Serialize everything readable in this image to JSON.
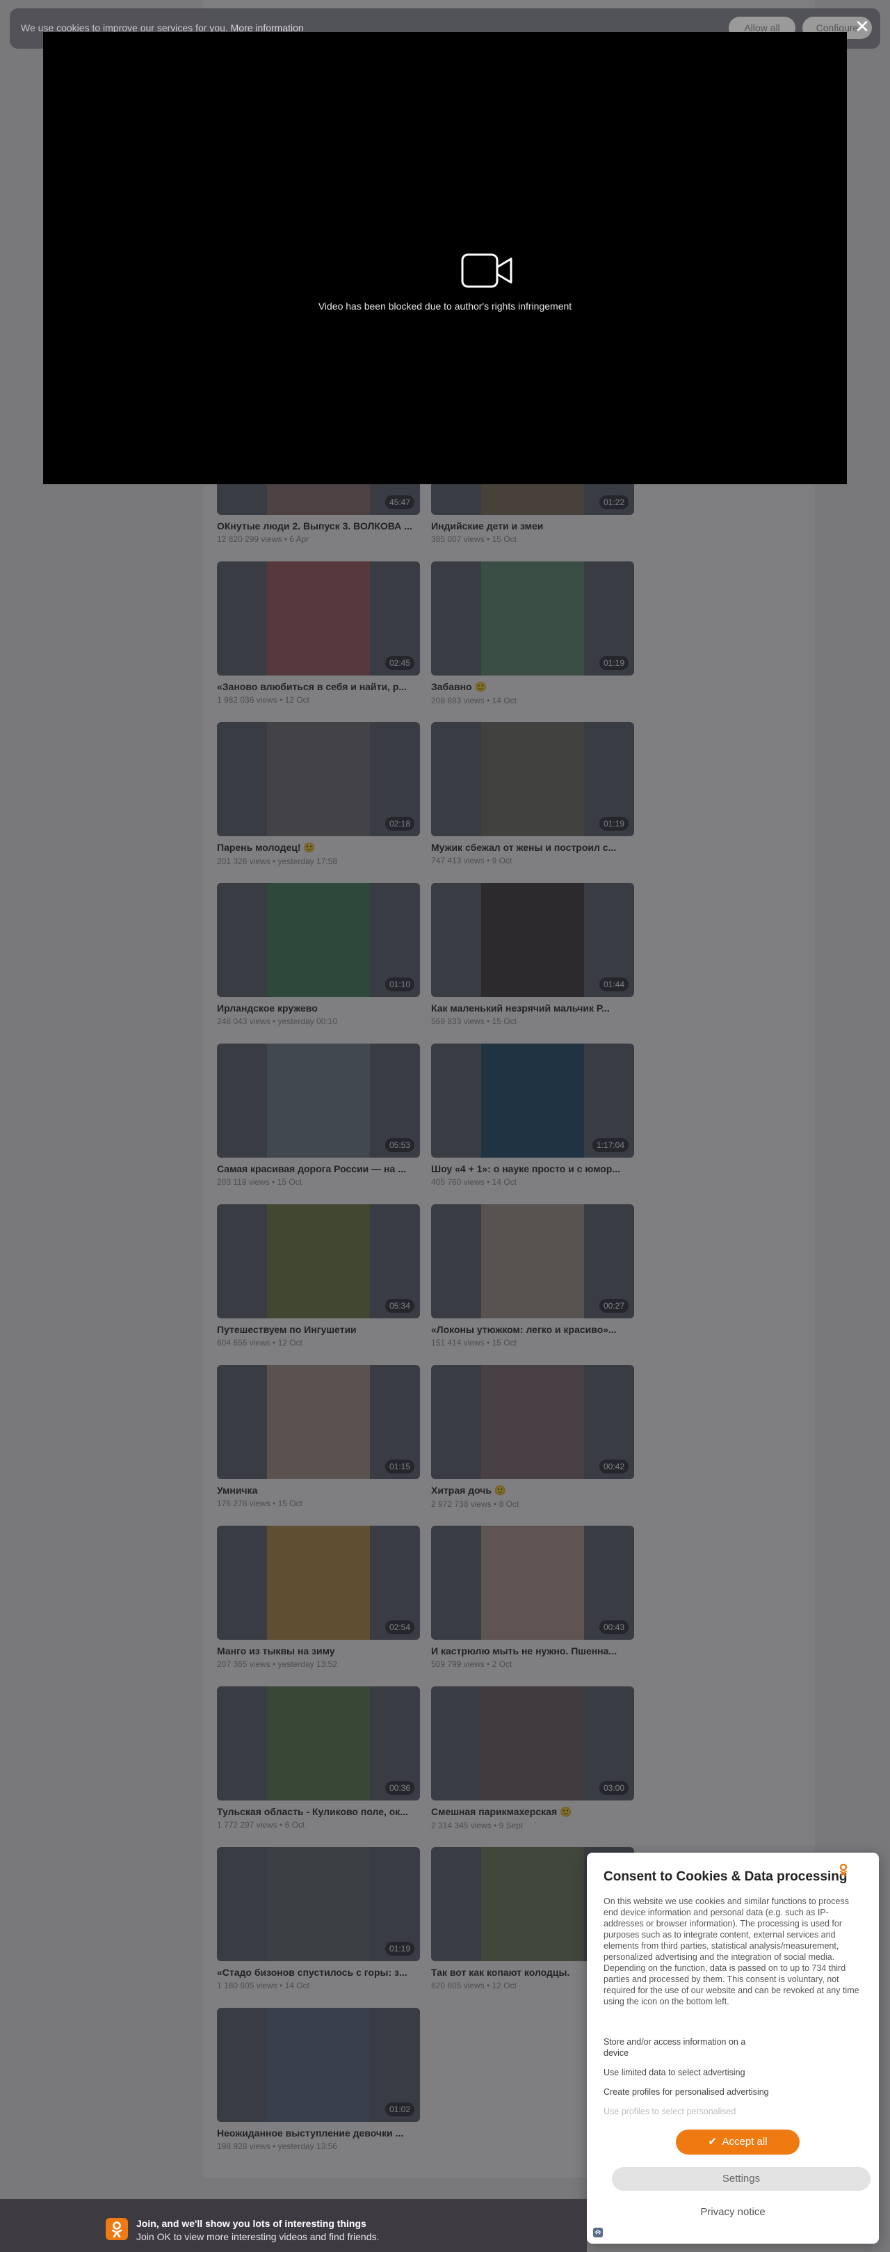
{
  "cookie_bar": {
    "text": "We use cookies to improve our services for you.",
    "link": "More information",
    "allow_all": "Allow all",
    "configure": "Configure"
  },
  "player": {
    "blocked_message": "Video has been blocked due to author's rights infringement",
    "icon": "video-camera-icon"
  },
  "videos": [
    {
      "title": "ОКнутые люди 2. Выпуск 3. ВОЛКОВА ...",
      "meta": "12 820 299 views • 6 Apr",
      "duration": "45:47",
      "color": "#8a6d6a"
    },
    {
      "title": "Индийские дети и змеи",
      "meta": "385 007 views • 15 Oct",
      "duration": "01:22",
      "color": "#7d6c54"
    },
    {
      "title": "«Заново влюбиться в себя и найти, р...",
      "meta": "1 982 036 views • 12 Oct",
      "duration": "02:45",
      "color": "#a0565a"
    },
    {
      "title": "Забавно 🙂",
      "meta": "208 883 views • 14 Oct",
      "duration": "01:19",
      "color": "#5d8a70"
    },
    {
      "title": "Парень молодец! 🙂",
      "meta": "201 326 views • yesterday 17:58",
      "duration": "02:18",
      "color": "#6e6e72"
    },
    {
      "title": "Мужик сбежал от жены и построил с...",
      "meta": "747 413 views • 9 Oct",
      "duration": "01:19",
      "color": "#6b6e60"
    },
    {
      "title": "Ирландское кружево",
      "meta": "248 043 views • yesterday 00:10",
      "duration": "01:10",
      "color": "#3f7d5a"
    },
    {
      "title": "Как маленький незрячий мальчик Р...",
      "meta": "569 833 views • 15 Oct",
      "duration": "01:44",
      "color": "#3a3634"
    },
    {
      "title": "Самая красивая дорога России — на ...",
      "meta": "203 119 views • 15 Oct",
      "duration": "05:53",
      "color": "#6f7d88"
    },
    {
      "title": "Шоу «4 + 1»: о науке просто и с юмор...",
      "meta": "405 760 views • 14 Oct",
      "duration": "1:17:04",
      "color": "#1c4a6a"
    },
    {
      "title": "Путешествуем по Ингушетии",
      "meta": "604 656 views • 12 Oct",
      "duration": "05:34",
      "color": "#6e7a3e"
    },
    {
      "title": "«Локоны утюжком: легко и красиво»...",
      "meta": "151 414 views • 15 Oct",
      "duration": "00:27",
      "color": "#a3958a"
    },
    {
      "title": "Умничка",
      "meta": "176 278 views • 15 Oct",
      "duration": "01:15",
      "color": "#a49484"
    },
    {
      "title": "Хитрая дочь 🙂",
      "meta": "2 972 738 views • 8 Oct",
      "duration": "00:42",
      "color": "#7c6a6e"
    },
    {
      "title": "Манго из тыквы на зиму",
      "meta": "207 365 views • yesterday 13:52",
      "duration": "02:54",
      "color": "#b48a3a"
    },
    {
      "title": "И кастрюлю мыть не нужно. Пшенна...",
      "meta": "509 799 views • 2 Oct",
      "duration": "00:43",
      "color": "#b29a8a"
    },
    {
      "title": "Тульская область - Куликово поле, ок...",
      "meta": "1 772 297 views • 6 Oct",
      "duration": "00:36",
      "color": "#5a7a4a"
    },
    {
      "title": "Смешная парикмахерская 🙂",
      "meta": "2 314 345 views • 9 Sept",
      "duration": "03:00",
      "color": "#6a5a5e"
    },
    {
      "title": "«Стадо бизонов спустилось с горы: з...",
      "meta": "1 180 605 views • 14 Oct",
      "duration": "01:19",
      "color": "#5e6a6e"
    },
    {
      "title": "Так вот как копают колодцы.",
      "meta": "620 605 views • 12 Oct",
      "duration": "",
      "color": "#6e7a5a"
    },
    {
      "title": "Неожиданное выступление девочки ...",
      "meta": "198 928 views • yesterday 13:56",
      "duration": "01:02",
      "color": "#5a6a7e"
    }
  ],
  "consent": {
    "title": "Consent to Cookies & Data processing",
    "description": "On this website we use cookies and similar functions to process end device information and personal data (e.g. such as IP-addresses or browser information). The processing is used for purposes such as to integrate content, external services and elements from third parties, statistical analysis/measurement, personalized advertising and the integration of social media. Depending on the function, data is passed on to up to 734 third parties and processed by them. This consent is voluntary, not required for the use of our website and can be revoked at any time using the icon on the bottom left.",
    "purposes": [
      "Store and/or access information on a device",
      "Use limited data to select advertising",
      "Create profiles for personalised advertising",
      "Use profiles to select personalised"
    ],
    "accept_label": "Accept all",
    "settings_label": "Settings",
    "privacy_label": "Privacy notice",
    "accent": "#f07a12"
  },
  "join_bar": {
    "headline": "Join, and we'll show you lots of interesting things",
    "subline": "Join OK to view more interesting videos and find friends."
  }
}
